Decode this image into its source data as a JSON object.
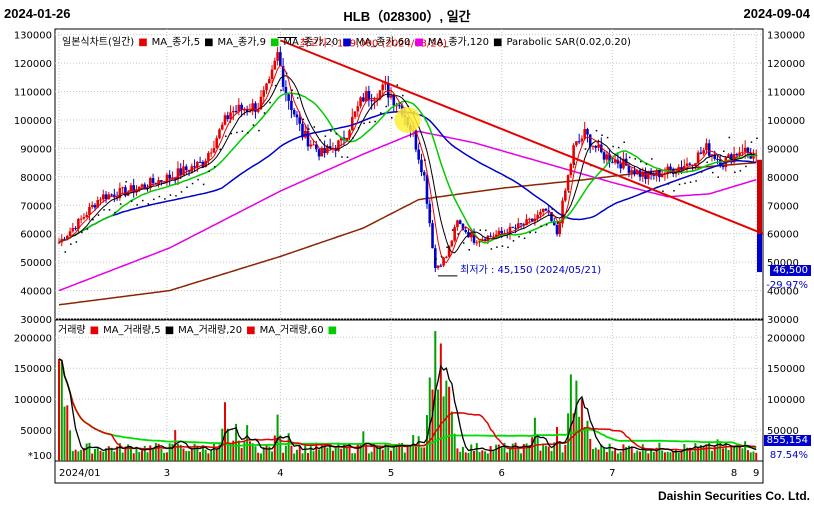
{
  "header": {
    "start_date": "2024-01-26",
    "title": "HLB（028300）, 일간",
    "end_date": "2024-09-04"
  },
  "footer": {
    "brand": "Daishin Securities Co. Ltd."
  },
  "colors": {
    "up": "#e60000",
    "down": "#0000cc",
    "ma5": "#e60000",
    "ma9": "#000000",
    "ma20": "#00cc00",
    "ma60": "#0000cc",
    "ma120": "#e600e6",
    "ma240": "#8b2500",
    "trend": "#e60000",
    "sar": "#000000"
  },
  "chart_data": [
    {
      "type": "line",
      "title": "일본식차트(일간)",
      "legend": [
        "일본식차트(일간)",
        "MA_종가,5",
        "MA_종가,9",
        "MA_종가,20",
        "MA_종가,60",
        "MA_종가,120",
        "Parabolic SAR(0.02,0.20)"
      ],
      "x_ticks": [
        "2024/01",
        "3",
        "4",
        "5",
        "6",
        "7",
        "8",
        "9"
      ],
      "y_ticks": [
        "130000",
        "120000",
        "110000",
        "100000",
        "90000",
        "80000",
        "70000",
        "60000",
        "50000",
        "40000",
        "30000"
      ],
      "ylim": [
        30000,
        132000
      ],
      "annotations": {
        "high_label": "최고가 : 129,000 (2024/03/26)",
        "low_label": "최저가 : 45,150 (2024/05/21)"
      },
      "last_price": "46,500",
      "change_pct": "-29.97%",
      "anchors": [
        {
          "t": 0,
          "v": 57000
        },
        {
          "t": 8,
          "v": 65000
        },
        {
          "t": 15,
          "v": 73000
        },
        {
          "t": 25,
          "v": 75000
        },
        {
          "t": 40,
          "v": 80000
        },
        {
          "t": 52,
          "v": 85000
        },
        {
          "t": 62,
          "v": 103000
        },
        {
          "t": 72,
          "v": 105000
        },
        {
          "t": 76,
          "v": 112000
        },
        {
          "t": 79,
          "v": 123000
        },
        {
          "t": 82,
          "v": 110000
        },
        {
          "t": 88,
          "v": 95000
        },
        {
          "t": 95,
          "v": 88000
        },
        {
          "t": 102,
          "v": 92000
        },
        {
          "t": 110,
          "v": 108000
        },
        {
          "t": 118,
          "v": 111000
        },
        {
          "t": 124,
          "v": 104000
        },
        {
          "t": 128,
          "v": 95000
        },
        {
          "t": 132,
          "v": 80000
        },
        {
          "t": 136,
          "v": 48000
        },
        {
          "t": 140,
          "v": 52000
        },
        {
          "t": 144,
          "v": 64000
        },
        {
          "t": 150,
          "v": 58000
        },
        {
          "t": 160,
          "v": 60000
        },
        {
          "t": 170,
          "v": 64000
        },
        {
          "t": 176,
          "v": 68000
        },
        {
          "t": 180,
          "v": 60000
        },
        {
          "t": 183,
          "v": 75000
        },
        {
          "t": 186,
          "v": 90000
        },
        {
          "t": 190,
          "v": 95000
        },
        {
          "t": 196,
          "v": 88000
        },
        {
          "t": 203,
          "v": 85000
        },
        {
          "t": 212,
          "v": 80000
        },
        {
          "t": 220,
          "v": 82000
        },
        {
          "t": 228,
          "v": 85000
        },
        {
          "t": 234,
          "v": 90000
        },
        {
          "t": 240,
          "v": 85000
        },
        {
          "t": 247,
          "v": 90000
        },
        {
          "t": 252,
          "v": 86000
        }
      ],
      "ma120_pts": [
        {
          "t": 0,
          "v": 40000
        },
        {
          "t": 40,
          "v": 55000
        },
        {
          "t": 80,
          "v": 75000
        },
        {
          "t": 110,
          "v": 88000
        },
        {
          "t": 130,
          "v": 96000
        },
        {
          "t": 150,
          "v": 92000
        },
        {
          "t": 175,
          "v": 85000
        },
        {
          "t": 200,
          "v": 78000
        },
        {
          "t": 220,
          "v": 73000
        },
        {
          "t": 235,
          "v": 74000
        },
        {
          "t": 252,
          "v": 79000
        }
      ],
      "ma240_pts": [
        {
          "t": 0,
          "v": 35000
        },
        {
          "t": 40,
          "v": 40000
        },
        {
          "t": 80,
          "v": 52000
        },
        {
          "t": 110,
          "v": 62000
        },
        {
          "t": 130,
          "v": 72000
        },
        {
          "t": 160,
          "v": 76000
        },
        {
          "t": 190,
          "v": 79000
        },
        {
          "t": 215,
          "v": 82000
        },
        {
          "t": 252,
          "v": 85000
        }
      ],
      "trend_line": [
        {
          "t": 80,
          "v": 128000
        },
        {
          "t": 262,
          "v": 60000
        }
      ]
    },
    {
      "type": "bar",
      "title": "거래량",
      "legend": [
        "거래량",
        "MA_거래량,5",
        "MA_거래량,20",
        "MA_거래량,60"
      ],
      "y_ticks": [
        "200000",
        "150000",
        "100000",
        "50000"
      ],
      "ylim": [
        0,
        215000
      ],
      "unit": "*100",
      "last_volume": "855,154",
      "ratio": "87.54%",
      "spikes": [
        {
          "t": 0,
          "v": 165000
        },
        {
          "t": 1,
          "v": 160000
        },
        {
          "t": 3,
          "v": 90000
        },
        {
          "t": 42,
          "v": 50000
        },
        {
          "t": 60,
          "v": 95000
        },
        {
          "t": 64,
          "v": 60000
        },
        {
          "t": 68,
          "v": 58000
        },
        {
          "t": 79,
          "v": 75000
        },
        {
          "t": 83,
          "v": 45000
        },
        {
          "t": 110,
          "v": 48000
        },
        {
          "t": 128,
          "v": 42000
        },
        {
          "t": 130,
          "v": 40000
        },
        {
          "t": 134,
          "v": 135000
        },
        {
          "t": 136,
          "v": 210000
        },
        {
          "t": 138,
          "v": 190000
        },
        {
          "t": 140,
          "v": 130000
        },
        {
          "t": 141,
          "v": 120000
        },
        {
          "t": 142,
          "v": 80000
        },
        {
          "t": 172,
          "v": 70000
        },
        {
          "t": 180,
          "v": 55000
        },
        {
          "t": 185,
          "v": 140000
        },
        {
          "t": 187,
          "v": 130000
        },
        {
          "t": 189,
          "v": 100000
        },
        {
          "t": 191,
          "v": 65000
        },
        {
          "t": 238,
          "v": 35000
        },
        {
          "t": 248,
          "v": 32000
        }
      ]
    }
  ]
}
